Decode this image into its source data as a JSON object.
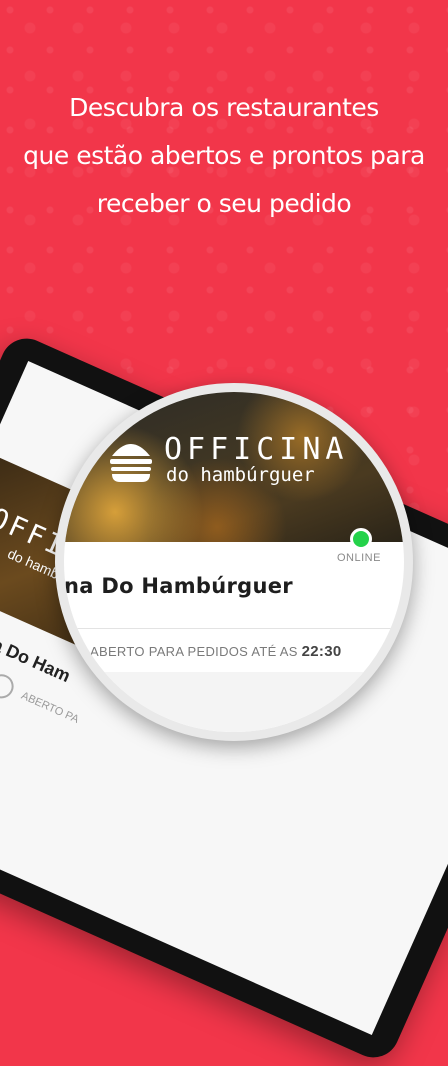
{
  "headline": {
    "line1": "Descubra os restaurantes",
    "line2": "que estão abertos e prontos para",
    "line3": "receber o seu pedido"
  },
  "restaurant": {
    "logo_title": "OFFICINA",
    "logo_subtitle": "do hambúrguer",
    "name": "na Do Hambúrguer",
    "status_badge": "ONLINE",
    "status_color": "#24d24a",
    "hours_prefix": "ABERTO PARA PEDIDOS ATÉ AS",
    "hours_time": "22:30"
  },
  "background_card": {
    "logo_title": "OFFICIN",
    "logo_subtitle": "do hamb",
    "name": "fficina Do Ham",
    "status_partial": "ABERTO PA"
  },
  "colors": {
    "brand_red": "#f2364a",
    "accent_yellow": "#f5b400"
  }
}
